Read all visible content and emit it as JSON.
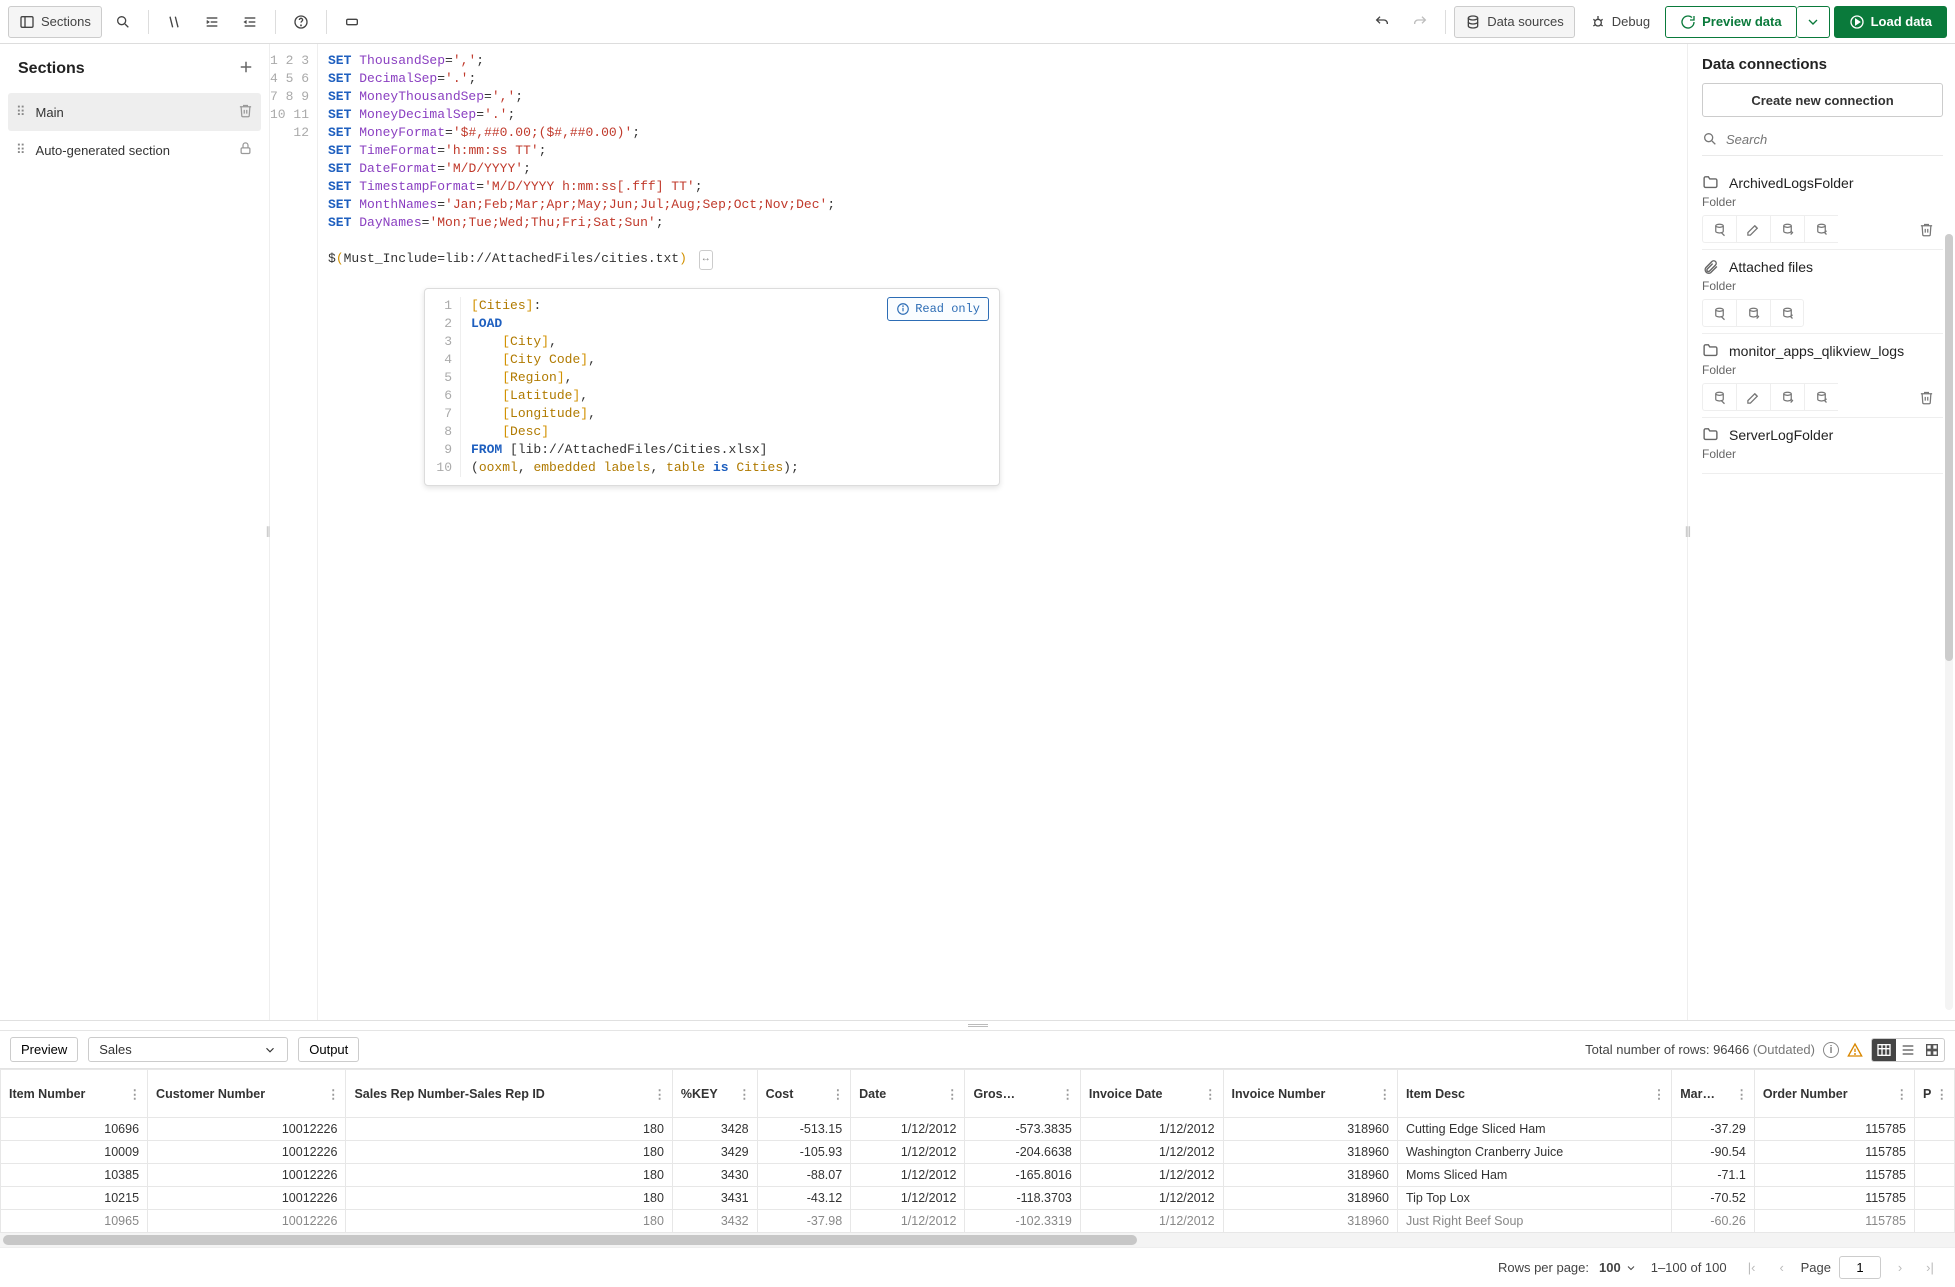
{
  "toolbar": {
    "sections_btn": "Sections",
    "data_sources": "Data sources",
    "debug": "Debug",
    "preview_data": "Preview data",
    "load_data": "Load data"
  },
  "sidebar": {
    "title": "Sections",
    "items": [
      {
        "label": "Main",
        "active": true,
        "deletable": true
      },
      {
        "label": "Auto-generated section",
        "active": false,
        "locked": true
      }
    ]
  },
  "editor": {
    "lines": [
      {
        "n": 1,
        "tokens": [
          [
            "kw",
            "SET"
          ],
          [
            "sp",
            " "
          ],
          [
            "var",
            "ThousandSep"
          ],
          [
            "op",
            "="
          ],
          [
            "str",
            "','"
          ],
          [
            "op",
            ";"
          ]
        ]
      },
      {
        "n": 2,
        "tokens": [
          [
            "kw",
            "SET"
          ],
          [
            "sp",
            " "
          ],
          [
            "var",
            "DecimalSep"
          ],
          [
            "op",
            "="
          ],
          [
            "str",
            "'.'"
          ],
          [
            "op",
            ";"
          ]
        ]
      },
      {
        "n": 3,
        "tokens": [
          [
            "kw",
            "SET"
          ],
          [
            "sp",
            " "
          ],
          [
            "var",
            "MoneyThousandSep"
          ],
          [
            "op",
            "="
          ],
          [
            "str",
            "','"
          ],
          [
            "op",
            ";"
          ]
        ]
      },
      {
        "n": 4,
        "tokens": [
          [
            "kw",
            "SET"
          ],
          [
            "sp",
            " "
          ],
          [
            "var",
            "MoneyDecimalSep"
          ],
          [
            "op",
            "="
          ],
          [
            "str",
            "'.'"
          ],
          [
            "op",
            ";"
          ]
        ]
      },
      {
        "n": 5,
        "tokens": [
          [
            "kw",
            "SET"
          ],
          [
            "sp",
            " "
          ],
          [
            "var",
            "MoneyFormat"
          ],
          [
            "op",
            "="
          ],
          [
            "str",
            "'$#,##0.00;($#,##0.00)'"
          ],
          [
            "op",
            ";"
          ]
        ]
      },
      {
        "n": 6,
        "tokens": [
          [
            "kw",
            "SET"
          ],
          [
            "sp",
            " "
          ],
          [
            "var",
            "TimeFormat"
          ],
          [
            "op",
            "="
          ],
          [
            "str",
            "'h:mm:ss TT'"
          ],
          [
            "op",
            ";"
          ]
        ]
      },
      {
        "n": 7,
        "tokens": [
          [
            "kw",
            "SET"
          ],
          [
            "sp",
            " "
          ],
          [
            "var",
            "DateFormat"
          ],
          [
            "op",
            "="
          ],
          [
            "str",
            "'M/D/YYYY'"
          ],
          [
            "op",
            ";"
          ]
        ]
      },
      {
        "n": 8,
        "tokens": [
          [
            "kw",
            "SET"
          ],
          [
            "sp",
            " "
          ],
          [
            "var",
            "TimestampFormat"
          ],
          [
            "op",
            "="
          ],
          [
            "str",
            "'M/D/YYYY h:mm:ss[.fff] TT'"
          ],
          [
            "op",
            ";"
          ]
        ]
      },
      {
        "n": 9,
        "tokens": [
          [
            "kw",
            "SET"
          ],
          [
            "sp",
            " "
          ],
          [
            "var",
            "MonthNames"
          ],
          [
            "op",
            "="
          ],
          [
            "str",
            "'Jan;Feb;Mar;Apr;May;Jun;Jul;Aug;Sep;Oct;Nov;Dec'"
          ],
          [
            "op",
            ";"
          ]
        ]
      },
      {
        "n": 10,
        "tokens": [
          [
            "kw",
            "SET"
          ],
          [
            "sp",
            " "
          ],
          [
            "var",
            "DayNames"
          ],
          [
            "op",
            "="
          ],
          [
            "str",
            "'Mon;Tue;Wed;Thu;Fri;Sat;Sun'"
          ],
          [
            "op",
            ";"
          ]
        ]
      },
      {
        "n": 11,
        "tokens": []
      },
      {
        "n": 12,
        "tokens": [
          [
            "op",
            "$"
          ],
          [
            "br",
            "("
          ],
          [
            "op",
            "Must_Include=lib://AttachedFiles/cities.txt"
          ],
          [
            "br",
            ")"
          ]
        ],
        "expand": true
      }
    ],
    "inline": {
      "readonly_label": "Read only",
      "lines": [
        {
          "n": 1,
          "tokens": [
            [
              "br",
              "["
            ],
            [
              "fn",
              "Cities"
            ],
            [
              "br",
              "]"
            ],
            [
              "op",
              ":"
            ]
          ]
        },
        {
          "n": 2,
          "tokens": [
            [
              "kw",
              "LOAD"
            ]
          ]
        },
        {
          "n": 3,
          "tokens": [
            [
              "sp",
              "    "
            ],
            [
              "br",
              "["
            ],
            [
              "fn",
              "City"
            ],
            [
              "br",
              "]"
            ],
            [
              "op",
              ","
            ]
          ]
        },
        {
          "n": 4,
          "tokens": [
            [
              "sp",
              "    "
            ],
            [
              "br",
              "["
            ],
            [
              "fn",
              "City Code"
            ],
            [
              "br",
              "]"
            ],
            [
              "op",
              ","
            ]
          ]
        },
        {
          "n": 5,
          "tokens": [
            [
              "sp",
              "    "
            ],
            [
              "br",
              "["
            ],
            [
              "fn",
              "Region"
            ],
            [
              "br",
              "]"
            ],
            [
              "op",
              ","
            ]
          ]
        },
        {
          "n": 6,
          "tokens": [
            [
              "sp",
              "    "
            ],
            [
              "br",
              "["
            ],
            [
              "fn",
              "Latitude"
            ],
            [
              "br",
              "]"
            ],
            [
              "op",
              ","
            ]
          ]
        },
        {
          "n": 7,
          "tokens": [
            [
              "sp",
              "    "
            ],
            [
              "br",
              "["
            ],
            [
              "fn",
              "Longitude"
            ],
            [
              "br",
              "]"
            ],
            [
              "op",
              ","
            ]
          ]
        },
        {
          "n": 8,
          "tokens": [
            [
              "sp",
              "    "
            ],
            [
              "br",
              "["
            ],
            [
              "fn",
              "Desc"
            ],
            [
              "br",
              "]"
            ]
          ]
        },
        {
          "n": 9,
          "tokens": [
            [
              "kw",
              "FROM"
            ],
            [
              "sp",
              " "
            ],
            [
              "op",
              "[lib://AttachedFiles/Cities.xlsx]"
            ]
          ]
        },
        {
          "n": 10,
          "tokens": [
            [
              "op",
              "("
            ],
            [
              "fn",
              "ooxml"
            ],
            [
              "op",
              ", "
            ],
            [
              "fn",
              "embedded"
            ],
            [
              "sp",
              " "
            ],
            [
              "fn",
              "labels"
            ],
            [
              "op",
              ", "
            ],
            [
              "fn",
              "table"
            ],
            [
              "sp",
              " "
            ],
            [
              "kw",
              "is"
            ],
            [
              "sp",
              " "
            ],
            [
              "fn",
              "Cities"
            ],
            [
              "op",
              ");"
            ]
          ]
        }
      ]
    }
  },
  "connections": {
    "title": "Data connections",
    "create_label": "Create new connection",
    "search_placeholder": "Search",
    "items": [
      {
        "name": "ArchivedLogsFolder",
        "type": "Folder",
        "icon": "folder",
        "actions": [
          "select",
          "edit",
          "insert",
          "view",
          "delete"
        ]
      },
      {
        "name": "Attached files",
        "type": "Folder",
        "icon": "attachment",
        "actions": [
          "select",
          "insert",
          "view"
        ]
      },
      {
        "name": "monitor_apps_qlikview_logs",
        "type": "Folder",
        "icon": "folder",
        "actions": [
          "select",
          "edit",
          "insert",
          "view",
          "delete"
        ]
      },
      {
        "name": "ServerLogFolder",
        "type": "Folder",
        "icon": "folder",
        "actions": []
      }
    ]
  },
  "preview": {
    "preview_btn": "Preview",
    "output_btn": "Output",
    "table_select": "Sales",
    "total_rows_label": "Total number of rows: ",
    "total_rows_value": "96466",
    "outdated": "(Outdated)",
    "columns": [
      "Item Number",
      "Customer Number",
      "Sales Rep Number-Sales Rep ID",
      "%KEY",
      "Cost",
      "Date",
      "Gros…",
      "Invoice Date",
      "Invoice Number",
      "Item Desc",
      "Mar…",
      "Order Number",
      "P"
    ],
    "col_align": [
      "num",
      "num",
      "num",
      "num",
      "num",
      "num",
      "num",
      "num",
      "num",
      "text",
      "num",
      "num",
      "text"
    ],
    "rows": [
      [
        "10696",
        "10012226",
        "180",
        "3428",
        "-513.15",
        "1/12/2012",
        "-573.3835",
        "1/12/2012",
        "318960",
        "Cutting Edge Sliced Ham",
        "-37.29",
        "115785",
        ""
      ],
      [
        "10009",
        "10012226",
        "180",
        "3429",
        "-105.93",
        "1/12/2012",
        "-204.6638",
        "1/12/2012",
        "318960",
        "Washington Cranberry Juice",
        "-90.54",
        "115785",
        ""
      ],
      [
        "10385",
        "10012226",
        "180",
        "3430",
        "-88.07",
        "1/12/2012",
        "-165.8016",
        "1/12/2012",
        "318960",
        "Moms Sliced Ham",
        "-71.1",
        "115785",
        ""
      ],
      [
        "10215",
        "10012226",
        "180",
        "3431",
        "-43.12",
        "1/12/2012",
        "-118.3703",
        "1/12/2012",
        "318960",
        "Tip Top Lox",
        "-70.52",
        "115785",
        ""
      ],
      [
        "10965",
        "10012226",
        "180",
        "3432",
        "-37.98",
        "1/12/2012",
        "-102.3319",
        "1/12/2012",
        "318960",
        "Just Right Beef Soup",
        "-60.26",
        "115785",
        ""
      ]
    ],
    "pager": {
      "rows_per_page_label": "Rows per page:",
      "rows_per_page_value": "100",
      "range": "1–100 of 100",
      "page_label": "Page",
      "page_value": "1"
    }
  }
}
